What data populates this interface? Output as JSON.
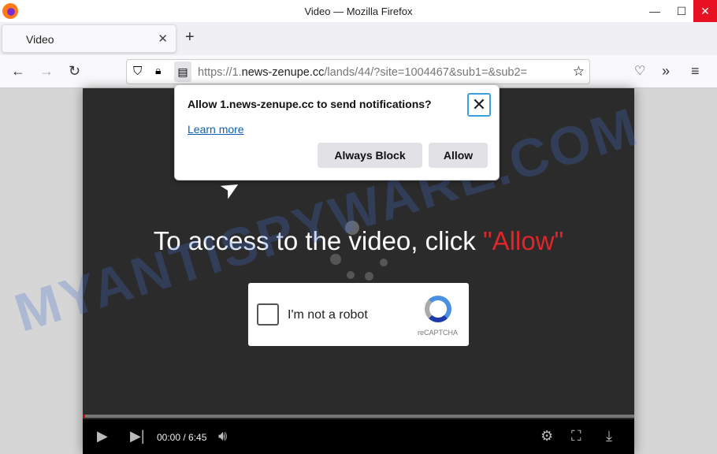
{
  "window": {
    "title": "Video — Mozilla Firefox"
  },
  "tab": {
    "label": "Video"
  },
  "url": {
    "prefix": "https://1.",
    "domain": "news-zenupe.cc",
    "path": "/lands/44/?site=1004467&sub1=&sub2="
  },
  "popup": {
    "question": "Allow 1.news-zenupe.cc to send notifications?",
    "learn_more": "Learn more",
    "block": "Always Block",
    "allow": "Allow"
  },
  "page": {
    "headline": "To access to the video, click ",
    "headline_allow": "\"Allow\"",
    "captcha_label": "I'm not a robot",
    "captcha_brand": "reCAPTCHA",
    "watermark": "MYANTISPYWARE.COM"
  },
  "player": {
    "time": "00:00 / 6:45",
    "progress_percent": 0.4
  }
}
